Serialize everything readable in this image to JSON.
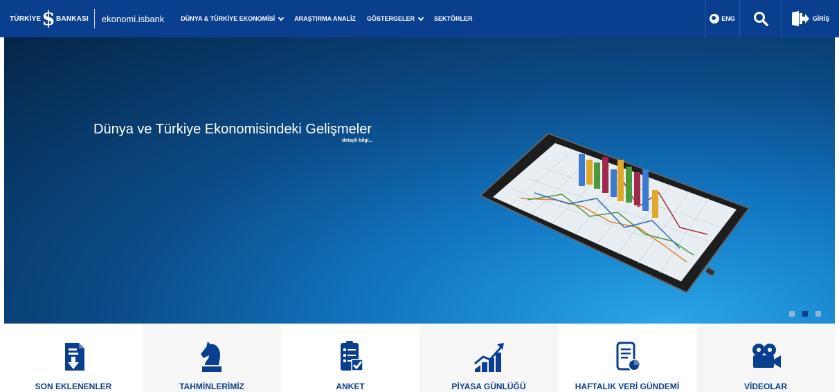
{
  "nav": {
    "brand_left": "TÜRKİYE",
    "brand_s": "$",
    "brand_right": "BANKASI",
    "site": "ekonomi.isbank",
    "menu": [
      {
        "label": "DÜNYA & TÜRKİYE EKONOMİSİ",
        "dropdown": true
      },
      {
        "label": "ARAŞTIRMA ANALİZ",
        "dropdown": false
      },
      {
        "label": "GÖSTERGELER",
        "dropdown": true
      },
      {
        "label": "SEKTÖRLER",
        "dropdown": false
      }
    ],
    "lang": "ENG",
    "login": "GİRİŞ"
  },
  "hero": {
    "title": "Dünya ve Türkiye Ekonomisindeki Gelişmeler",
    "subtitle": "detaylı bilgi...",
    "slides": 3,
    "active_slide": 2
  },
  "tiles": [
    {
      "label": "SON EKLENENLER",
      "icon": "document-download-icon"
    },
    {
      "label": "TAHMİNLERİMİZ",
      "icon": "chess-knight-icon"
    },
    {
      "label": "ANKET",
      "icon": "survey-checklist-icon"
    },
    {
      "label": "PİYASA GÜNLÜĞÜ",
      "icon": "growth-chart-icon"
    },
    {
      "label": "HAFTALIK VERİ GÜNDEMİ",
      "icon": "report-pie-icon"
    },
    {
      "label": "VİDEOLAR",
      "icon": "video-camera-icon"
    }
  ],
  "colors": {
    "brand_blue": "#0a3f8f",
    "hero_light": "#2aa6e6",
    "tile_alt_bg": "#f6f6f6"
  }
}
